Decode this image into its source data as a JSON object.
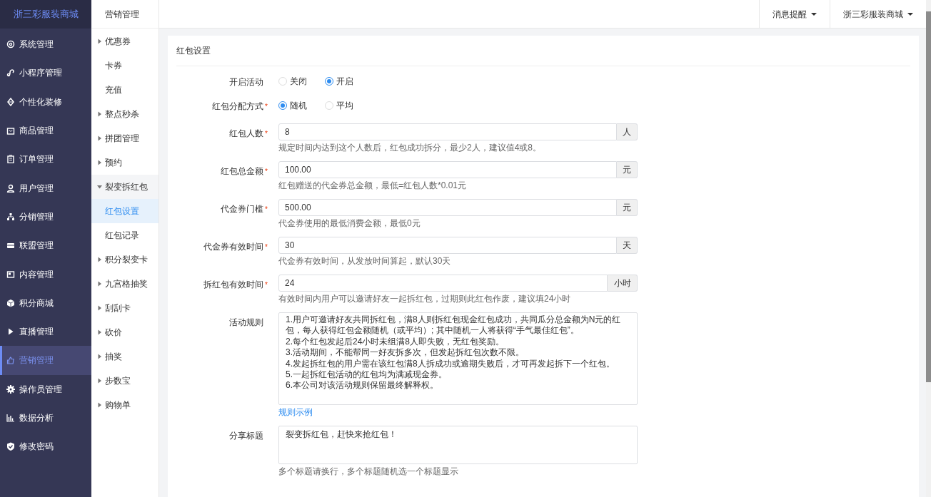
{
  "brand": "浙三彩服装商城",
  "sidebar": {
    "items": [
      {
        "label": "系统管理",
        "selected": false
      },
      {
        "label": "小程序管理",
        "selected": false
      },
      {
        "label": "个性化装修",
        "selected": false
      },
      {
        "label": "商品管理",
        "selected": false
      },
      {
        "label": "订单管理",
        "selected": false
      },
      {
        "label": "用户管理",
        "selected": false
      },
      {
        "label": "分销管理",
        "selected": false
      },
      {
        "label": "联盟管理",
        "selected": false
      },
      {
        "label": "内容管理",
        "selected": false
      },
      {
        "label": "积分商城",
        "selected": false
      },
      {
        "label": "直播管理",
        "selected": false
      },
      {
        "label": "营销管理",
        "selected": true
      },
      {
        "label": "操作员管理",
        "selected": false
      },
      {
        "label": "数据分析",
        "selected": false
      },
      {
        "label": "修改密码",
        "selected": false
      }
    ]
  },
  "submenu": {
    "title": "营销管理",
    "items": [
      {
        "kind": "group",
        "label": "优惠券",
        "expanded": false
      },
      {
        "kind": "link",
        "label": "卡券",
        "selected": false
      },
      {
        "kind": "link",
        "label": "充值",
        "selected": false
      },
      {
        "kind": "group",
        "label": "整点秒杀",
        "expanded": false
      },
      {
        "kind": "group",
        "label": "拼团管理",
        "expanded": false
      },
      {
        "kind": "group",
        "label": "预约",
        "expanded": false
      },
      {
        "kind": "group",
        "label": "裂变拆红包",
        "expanded": true,
        "children": [
          {
            "label": "红包设置",
            "selected": true
          },
          {
            "label": "红包记录",
            "selected": false
          }
        ]
      },
      {
        "kind": "group",
        "label": "积分裂变卡",
        "expanded": false
      },
      {
        "kind": "group",
        "label": "九宫格抽奖",
        "expanded": false
      },
      {
        "kind": "group",
        "label": "刮刮卡",
        "expanded": false
      },
      {
        "kind": "group",
        "label": "砍价",
        "expanded": false
      },
      {
        "kind": "group",
        "label": "抽奖",
        "expanded": false
      },
      {
        "kind": "group",
        "label": "步数宝",
        "expanded": false
      },
      {
        "kind": "group",
        "label": "购物单",
        "expanded": false
      }
    ]
  },
  "topbar": {
    "menus": [
      "消息提醒",
      "浙三彩服装商城"
    ]
  },
  "card": {
    "title": "红包设置",
    "fields": [
      {
        "kind": "radio",
        "label": "开启活动",
        "options": [
          {
            "label": "关闭",
            "selected": false
          },
          {
            "label": "开启",
            "selected": true
          }
        ]
      },
      {
        "kind": "radio",
        "label": "红包分配方式",
        "required_mark": "*",
        "options": [
          {
            "label": "随机",
            "selected": true
          },
          {
            "label": "平均",
            "selected": false
          }
        ]
      },
      {
        "kind": "input",
        "label": "红包人数",
        "required_mark": "*",
        "value": "8",
        "addon": "人",
        "help": "规定时间内达到这个人数后，红包成功拆分，最少2人，建议值4或8。"
      },
      {
        "kind": "input",
        "label": "红包总金额",
        "required_mark": "*",
        "value": "100.00",
        "addon": "元",
        "help": "红包赠送的代金券总金额，最低=红包人数*0.01元"
      },
      {
        "kind": "input",
        "label": "代金券门槛",
        "required_mark": "*",
        "value": "500.00",
        "addon": "元",
        "help": "代金券使用的最低消费金额，最低0元"
      },
      {
        "kind": "input",
        "label": "代金券有效时间",
        "required_mark": "*",
        "value": "30",
        "addon": "天",
        "help": "代金券有效时间，从发放时间算起，默认30天"
      },
      {
        "kind": "input",
        "label": "拆红包有效时间",
        "required_mark": "*",
        "value": "24",
        "addon": "小时",
        "help": "有效时间内用户可以邀请好友一起拆红包，过期则此红包作废，建议填24小时"
      },
      {
        "kind": "textarea",
        "label": "活动规则",
        "value": "1.用户可邀请好友共同拆红包，满8人则拆红包现金红包成功，共同瓜分总金额为N元的红包，每人获得红包金额随机（或平均）; 其中随机一人将获得“手气最佳红包”。\n2.每个红包发起后24小时未组满8人即失败，无红包奖励。\n3.活动期间，不能帮同一好友拆多次，但发起拆红包次数不限。\n4.发起拆红包的用户需在该红包满8人拆成功或逾期失败后，才可再发起拆下一个红包。\n5.一起拆红包活动的红包均为满减现金券。\n6.本公司对该活动规则保留最终解释权。",
        "link": "规则示例"
      },
      {
        "kind": "textarea",
        "label": "分享标题",
        "value": "裂变拆红包，赶快来抢红包！",
        "help": "多个标题请换行，多个标题随机选一个标题显示"
      }
    ]
  }
}
